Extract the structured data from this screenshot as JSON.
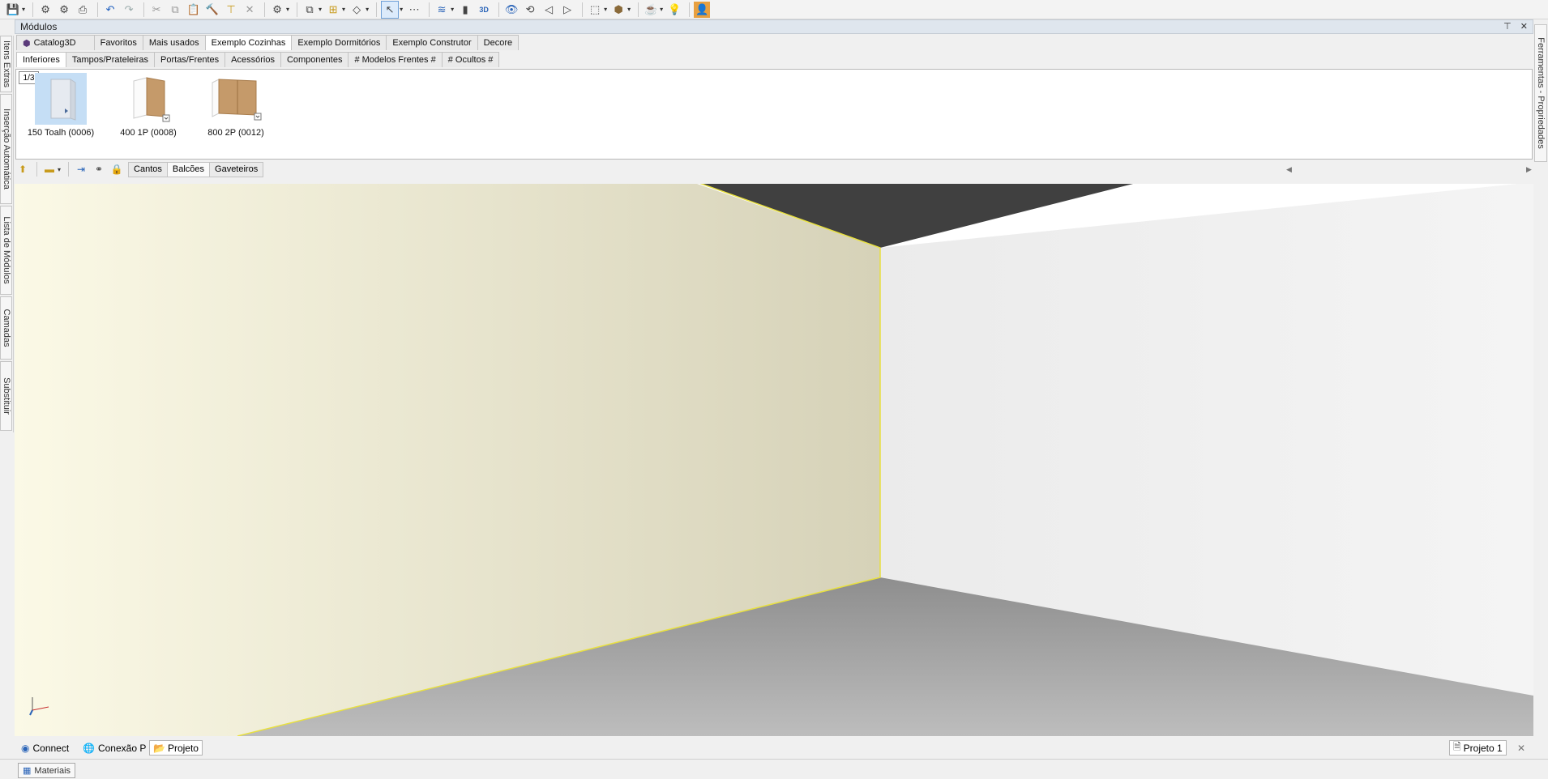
{
  "toolbar": {
    "icons": [
      "save-icon",
      "open-icon",
      "print-icon",
      "undo-icon",
      "redo-icon",
      "cut-icon",
      "copy-icon",
      "paste-icon",
      "format-painter-icon",
      "delete-icon",
      "settings-icon",
      "layers-icon",
      "align-icon",
      "select-icon",
      "measure-icon",
      "view3d-icon",
      "eye-icon",
      "render-icon",
      "user-icon"
    ],
    "view3d_label": "3D"
  },
  "left_dock": {
    "tabs": [
      "Itens Extras",
      "Inserção Automática",
      "Lista de Módulos",
      "Camadas",
      "Substituir"
    ]
  },
  "right_dock": {
    "tabs": [
      "Ferramentas - Propriedades"
    ]
  },
  "modules": {
    "title": "Módulos",
    "pin_icon": "⊤",
    "close_icon": "✕",
    "catalog_tabs": [
      {
        "label": "Catalog3D",
        "active": false
      },
      {
        "label": "Favoritos",
        "active": false
      },
      {
        "label": "Mais usados",
        "active": false
      },
      {
        "label": "Exemplo Cozinhas",
        "active": true
      },
      {
        "label": "Exemplo Dormitórios",
        "active": false
      },
      {
        "label": "Exemplo Construtor",
        "active": false
      },
      {
        "label": "Decore",
        "active": false
      }
    ],
    "category_tabs": [
      {
        "label": "Inferiores",
        "active": true
      },
      {
        "label": "Tampos/Prateleiras",
        "active": false
      },
      {
        "label": "Portas/Frentes",
        "active": false
      },
      {
        "label": "Acessórios",
        "active": false
      },
      {
        "label": "Componentes",
        "active": false
      },
      {
        "label": "# Modelos Frentes #",
        "active": false
      },
      {
        "label": "# Ocultos #",
        "active": false
      }
    ],
    "page_indicator": "1/3",
    "items": [
      {
        "caption": "150 Toalh (0006)",
        "selected": true
      },
      {
        "caption": "400 1P (0008)",
        "selected": false
      },
      {
        "caption": "800 2P (0012)",
        "selected": false
      }
    ]
  },
  "view_toolbar": {
    "tabs": [
      {
        "label": "Cantos",
        "active": false
      },
      {
        "label": "Balcões",
        "active": true
      },
      {
        "label": "Gaveteiros",
        "active": false
      }
    ]
  },
  "colors": {
    "left_wall": "#f5f2d8",
    "right_wall": "#ececec",
    "ceiling": "#404040",
    "floor": "#a8a8a8",
    "edge_highlight": "#e8e040"
  },
  "bottom_tabs": {
    "connect": "Connect",
    "conexao": "Conexão P",
    "projeto": "Projeto",
    "project_doc": "Projeto 1"
  },
  "status": {
    "materials": "Materiais"
  }
}
